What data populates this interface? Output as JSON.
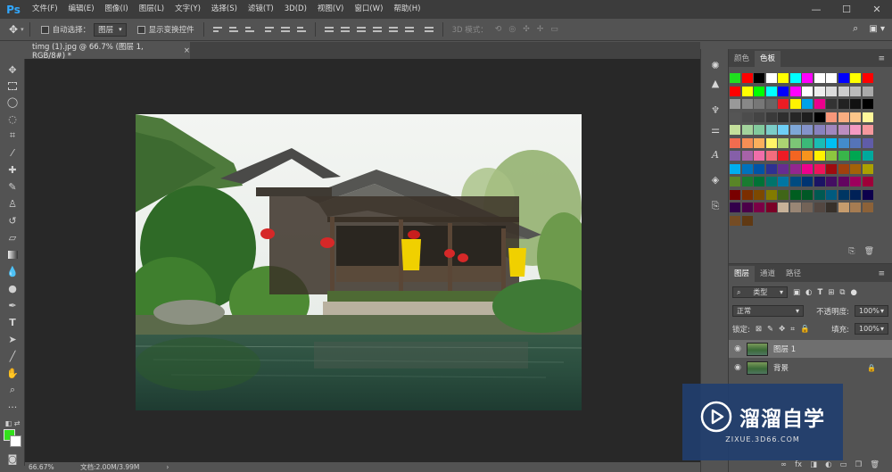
{
  "app": {
    "logo": "Ps",
    "menu": [
      "文件(F)",
      "编辑(E)",
      "图像(I)",
      "图层(L)",
      "文字(Y)",
      "选择(S)",
      "滤镜(T)",
      "3D(D)",
      "视图(V)",
      "窗口(W)",
      "帮助(H)"
    ],
    "window_controls": [
      "—",
      "☐",
      "✕"
    ]
  },
  "options": {
    "auto_select_label": "自动选择：",
    "auto_select_value": "图层",
    "show_transform_label": "显示变换控件",
    "mode_3d_label": "3D 模式："
  },
  "document": {
    "tab_title": "timg (1).jpg @ 66.7% (图层 1, RGB/8#) *",
    "tab_close": "×"
  },
  "status": {
    "zoom": "66.67%",
    "doc_info": "文档:2.00M/3.99M"
  },
  "colors": {
    "foreground": "#33e01b",
    "background": "#ffffff"
  },
  "swatches_panel": {
    "tabs": [
      "颜色",
      "色板"
    ],
    "active_tab": "色板",
    "swatch_rows": [
      [
        "#1fe01f",
        "#ff0000",
        "#000000",
        "#ffffff",
        "#ffff00",
        "#00ffff",
        "#ff00ff",
        "#ffffff",
        "#ffffff",
        "#0000ff",
        "#ffff00",
        "#ff0000"
      ],
      [
        "#ff0000",
        "#ffff00",
        "#00ff00",
        "#00ffff",
        "#0000ff",
        "#ff00ff",
        "#ffffff",
        "#eeeeee",
        "#dddddd",
        "#cccccc",
        "#bbbbbb",
        "#aaaaaa"
      ],
      [
        "#999999",
        "#888888",
        "#777777",
        "#666666",
        "#ed1c24",
        "#fff200",
        "#00a2e8",
        "#ec008c",
        "#333333",
        "#222222",
        "#111111",
        "#000000"
      ],
      [
        "#555555",
        "#4c4c4c",
        "#444444",
        "#3a3a3a",
        "#2e2e2e",
        "#262626",
        "#1e1e1e",
        "#000000",
        "#f7977a",
        "#f9ad81",
        "#fdc68a",
        "#fff79a"
      ],
      [
        "#c4df9b",
        "#a3d39c",
        "#82ca9d",
        "#7bcdc8",
        "#6ecff6",
        "#7ea7d8",
        "#8493ca",
        "#8882be",
        "#a187be",
        "#bc8dbf",
        "#f49ac2",
        "#f6989d"
      ],
      [
        "#f26c4f",
        "#f68e55",
        "#fbaf5c",
        "#fff467",
        "#acd372",
        "#7cc576",
        "#3bb878",
        "#1abbb4",
        "#00bff3",
        "#438ccb",
        "#5574b9",
        "#605ca8"
      ],
      [
        "#855fa8",
        "#a763a8",
        "#f06ea9",
        "#f26d7d",
        "#ed1c24",
        "#f26522",
        "#f7941d",
        "#fff200",
        "#8dc63f",
        "#39b54a",
        "#00a651",
        "#00a99d"
      ],
      [
        "#00aeef",
        "#0072bc",
        "#0054a6",
        "#2e3192",
        "#662d91",
        "#92278f",
        "#ec008c",
        "#ed145b",
        "#9e0b0f",
        "#a0410d",
        "#a36209",
        "#aba000"
      ],
      [
        "#598527",
        "#1a7b30",
        "#007236",
        "#00746b",
        "#0076a3",
        "#004b80",
        "#003471",
        "#1b1464",
        "#440e62",
        "#630460",
        "#9e005d",
        "#9e0039"
      ],
      [
        "#790000",
        "#7b2e00",
        "#7d4900",
        "#827b00",
        "#406618",
        "#005e20",
        "#005826",
        "#005952",
        "#005b7f",
        "#003663",
        "#002157",
        "#0d004c"
      ],
      [
        "#32004b",
        "#4b0049",
        "#7b0046",
        "#7a0026",
        "#c7b299",
        "#998675",
        "#736357",
        "#534741",
        "#37302a",
        "#c69c6d",
        "#a67c52",
        "#8c6239"
      ],
      [
        "#754c24",
        "#603913"
      ]
    ]
  },
  "layers_panel": {
    "tabs": [
      "图层",
      "通道",
      "路径"
    ],
    "active_tab": "图层",
    "filter_label": "类型",
    "blend_mode": "正常",
    "opacity_label": "不透明度:",
    "opacity_value": "100%",
    "lock_label": "锁定:",
    "fill_label": "填充:",
    "fill_value": "100%",
    "layers": [
      {
        "name": "图层 1",
        "selected": true
      },
      {
        "name": "背景",
        "selected": false,
        "locked": true
      }
    ],
    "footer_icons": [
      "∞",
      "fx",
      "◨",
      "◐",
      "▭",
      "❒",
      "🗑"
    ]
  },
  "watermark": {
    "title": "溜溜自学",
    "url": "ZIXUE.3D66.COM"
  }
}
